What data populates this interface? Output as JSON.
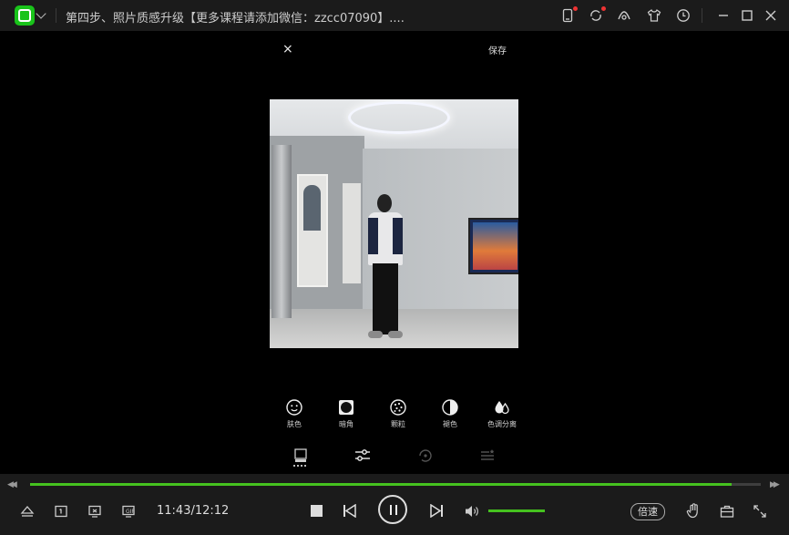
{
  "window": {
    "title": "第四步、照片质感升级【更多课程请添加微信：zzcc07090】....",
    "icons": [
      "app-logo",
      "dropdown",
      "mobile",
      "share",
      "skin",
      "theme",
      "history",
      "minimize",
      "maximize",
      "close"
    ]
  },
  "editor": {
    "close_label": "×",
    "save_label": "保存",
    "tools": [
      {
        "icon": "face-icon",
        "label": "肤色"
      },
      {
        "icon": "vignette-icon",
        "label": "暗角"
      },
      {
        "icon": "grain-icon",
        "label": "颗粒"
      },
      {
        "icon": "fade-icon",
        "label": "褪色"
      },
      {
        "icon": "split-tone-icon",
        "label": "色调分离"
      }
    ],
    "tabs": [
      "frame-tab",
      "adjust-tab",
      "rotate-tab",
      "filter-tab"
    ],
    "active_tab": "adjust-tab"
  },
  "player": {
    "current_time": "11:43",
    "total_time": "12:12",
    "time_display": "11:43/12:12",
    "progress": 0.96,
    "volume": 1.0,
    "speed_label": "倍速",
    "accent_color": "#45c21f"
  }
}
